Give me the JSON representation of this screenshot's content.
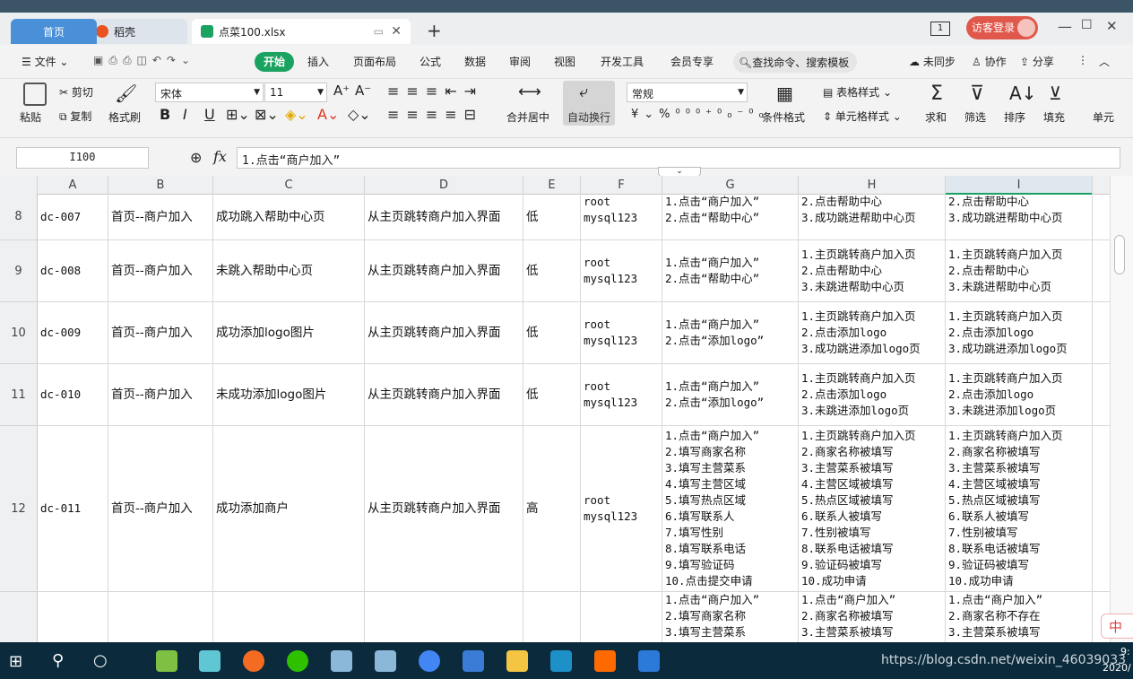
{
  "tabs": {
    "home": "首页",
    "daoke": "稻壳",
    "file": "点菜100.xlsx",
    "new_tab": "+"
  },
  "window": {
    "guest_login": "访客登录",
    "layout_icon_label": "1"
  },
  "menu": {
    "file": "文件",
    "start": "开始",
    "items": [
      "插入",
      "页面布局",
      "公式",
      "数据",
      "审阅",
      "视图",
      "开发工具",
      "会员专享"
    ],
    "search": "查找命令、搜索模板",
    "sync": "未同步",
    "collab": "协作",
    "share": "分享"
  },
  "ribbon": {
    "paste": "粘贴",
    "cut": "剪切",
    "copy": "复制",
    "format_painter": "格式刷",
    "font_name": "宋体",
    "font_size": "11",
    "merge_center": "合并居中",
    "wrap_text": "自动换行",
    "number_format": "常规",
    "cond_format": "条件格式",
    "table_style": "表格样式",
    "cell_style": "单元格样式",
    "sum": "求和",
    "filter": "筛选",
    "sort": "排序",
    "fill": "填充",
    "cell": "单元"
  },
  "formula_bar": {
    "name_box": "I100",
    "fx": "fx",
    "content": "1.点击“商户加入”"
  },
  "columns": [
    "A",
    "B",
    "C",
    "D",
    "E",
    "F",
    "G",
    "H",
    "I"
  ],
  "rows": [
    {
      "num": "8",
      "a": "dc-007",
      "b": "首页--商户加入",
      "c": "成功跳入帮助中心页",
      "d": "从主页跳转商户加入界面",
      "e": "低",
      "f": "root\nmysql123",
      "g": "1.点击“商户加入”\n2.点击“帮助中心”",
      "h": "2.点击帮助中心\n3.成功跳进帮助中心页",
      "i": "2.点击帮助中心\n3.成功跳进帮助中心页"
    },
    {
      "num": "9",
      "a": "dc-008",
      "b": "首页--商户加入",
      "c": "未跳入帮助中心页",
      "d": "从主页跳转商户加入界面",
      "e": "低",
      "f": "root\nmysql123",
      "g": "1.点击“商户加入”\n2.点击“帮助中心”",
      "h": "1.主页跳转商户加入页\n2.点击帮助中心\n3.未跳进帮助中心页",
      "i": "1.主页跳转商户加入页\n2.点击帮助中心\n3.未跳进帮助中心页"
    },
    {
      "num": "10",
      "a": "dc-009",
      "b": "首页--商户加入",
      "c": "成功添加logo图片",
      "d": "从主页跳转商户加入界面",
      "e": "低",
      "f": "root\nmysql123",
      "g": "1.点击“商户加入”\n2.点击“添加logo”",
      "h": "1.主页跳转商户加入页\n2.点击添加logo\n3.成功跳进添加logo页",
      "i": "1.主页跳转商户加入页\n2.点击添加logo\n3.成功跳进添加logo页"
    },
    {
      "num": "11",
      "a": "dc-010",
      "b": "首页--商户加入",
      "c": "未成功添加logo图片",
      "d": "从主页跳转商户加入界面",
      "e": "低",
      "f": "root\nmysql123",
      "g": "1.点击“商户加入”\n2.点击“添加logo”",
      "h": "1.主页跳转商户加入页\n2.点击添加logo\n3.未跳进添加logo页",
      "i": "1.主页跳转商户加入页\n2.点击添加logo\n3.未跳进添加logo页"
    },
    {
      "num": "12",
      "a": "dc-011",
      "b": "首页--商户加入",
      "c": "成功添加商户",
      "d": "从主页跳转商户加入界面",
      "e": "高",
      "f": "root\nmysql123",
      "g": "1.点击“商户加入”\n2.填写商家名称\n3.填写主营菜系\n4.填写主营区域\n5.填写热点区域\n6.填写联系人\n7.填写性别\n8.填写联系电话\n9.填写验证码\n10.点击提交申请",
      "h": "1.主页跳转商户加入页\n2.商家名称被填写\n3.主营菜系被填写\n4.主营区域被填写\n5.热点区域被填写\n6.联系人被填写\n7.性别被填写\n8.联系电话被填写\n9.验证码被填写\n10.成功申请",
      "i": "1.主页跳转商户加入页\n2.商家名称被填写\n3.主营菜系被填写\n4.主营区域被填写\n5.热点区域被填写\n6.联系人被填写\n7.性别被填写\n8.联系电话被填写\n9.验证码被填写\n10.成功申请"
    },
    {
      "num": "",
      "a": "",
      "b": "",
      "c": "",
      "d": "",
      "e": "",
      "f": "",
      "g": "1.点击“商户加入”\n2.填写商家名称\n3.填写主营菜系",
      "h": "1.点击“商户加入”\n2.商家名称被填写\n3.主营菜系被填写",
      "i": "1.点击“商户加入”\n2.商家名称不存在\n3.主营菜系被填写"
    }
  ],
  "taskbar": {
    "watermark": "https://blog.csdn.net/weixin_46039033",
    "time": "9:",
    "date": "2020/"
  },
  "ime": "中"
}
